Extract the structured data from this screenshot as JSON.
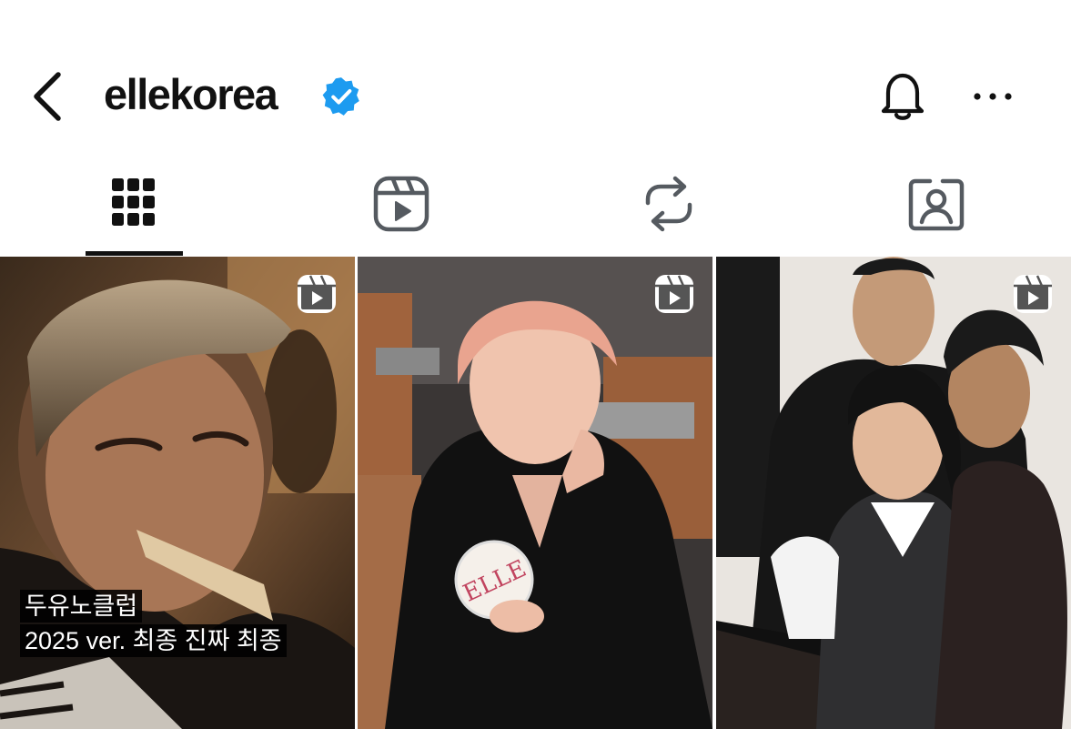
{
  "header": {
    "username": "ellekorea",
    "back_icon": "chevron-left-icon",
    "verified_icon": "verified-badge-icon",
    "bell_icon": "bell-icon",
    "more_icon": "more-horizontal-icon"
  },
  "tabs": [
    {
      "name": "grid",
      "icon": "grid-icon",
      "active": true
    },
    {
      "name": "reels",
      "icon": "reels-icon",
      "active": false
    },
    {
      "name": "reposts",
      "icon": "repost-icon",
      "active": false
    },
    {
      "name": "tagged",
      "icon": "tagged-person-icon",
      "active": false
    }
  ],
  "posts": [
    {
      "type": "reel",
      "caption_line1": "두유노클럽",
      "caption_line2": "2025 ver. 최종 진짜 최종",
      "image": "man-with-card-in-mouth"
    },
    {
      "type": "reel",
      "caption_line1": "",
      "caption_line2": "",
      "image": "man-holding-elle-compact"
    },
    {
      "type": "reel",
      "caption_line1": "",
      "caption_line2": "",
      "image": "woman-in-vest-with-crowd"
    }
  ],
  "colors": {
    "verified": "#1d9bf0",
    "text": "#111111",
    "icon_gray": "#555a60"
  }
}
